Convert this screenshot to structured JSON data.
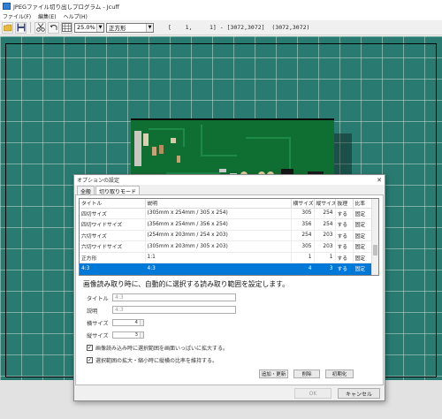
{
  "window": {
    "title": "JPEGファイル切り出しプログラム - Jcuff",
    "menu": [
      "ファイル(F)",
      "編集(E)",
      "ヘルプ(H)"
    ]
  },
  "toolbar": {
    "zoom_value": "25.0%",
    "shape_value": "正方形",
    "coord_readout": "[    1,     1] - [3072,3072]  (3072,3072)"
  },
  "dialog": {
    "title": "オプションの設定",
    "close_glyph": "✕",
    "tabs": [
      {
        "label": "全般",
        "active": false
      },
      {
        "label": "切り取りモード",
        "active": true
      }
    ],
    "table": {
      "headers": [
        "タイトル",
        "説明",
        "横サイズ",
        "縦サイズ",
        "抜理",
        "比率"
      ],
      "rows": [
        {
          "title": "四切サイズ",
          "desc": "(305mm x 254mm / 305 x 254)",
          "w": "305",
          "h": "254",
          "fit": "する",
          "ratio": "固定"
        },
        {
          "title": "四切ワイドサイズ",
          "desc": "(356mm x 254mm / 356 x 254)",
          "w": "356",
          "h": "254",
          "fit": "する",
          "ratio": "固定"
        },
        {
          "title": "六切サイズ",
          "desc": "(254mm x 203mm / 254 x 203)",
          "w": "254",
          "h": "203",
          "fit": "する",
          "ratio": "固定"
        },
        {
          "title": "六切ワイドサイズ",
          "desc": "(305mm x 203mm / 305 x 203)",
          "w": "305",
          "h": "203",
          "fit": "する",
          "ratio": "固定"
        },
        {
          "title": "正方形",
          "desc": "1:1",
          "w": "1",
          "h": "1",
          "fit": "する",
          "ratio": "固定"
        },
        {
          "title": "4:3",
          "desc": "4:3",
          "w": "4",
          "h": "3",
          "fit": "する",
          "ratio": "固定",
          "selected": true
        }
      ]
    },
    "form": {
      "heading": "画像読み取り時に、自動的に選択する読み取り範囲を設定します。",
      "title_label": "タイトル",
      "title_value": "4:3",
      "desc_label": "説明",
      "desc_value": "4:3",
      "width_label": "横サイズ",
      "width_value": "4",
      "height_label": "縦サイズ",
      "height_value": "3",
      "check1_label": "画像読み込み時に選択範囲を画面いっぱいに拡大する。",
      "check1_checked": true,
      "check2_label": "選択範囲の拡大・縮小時に縦横の比率を維持する。",
      "check2_checked": true,
      "check_glyph": "✓",
      "add_update_label": "追加・更新",
      "delete_label": "削除",
      "init_label": "初期化"
    },
    "ok_label": "OK",
    "cancel_label": "キャンセル"
  }
}
